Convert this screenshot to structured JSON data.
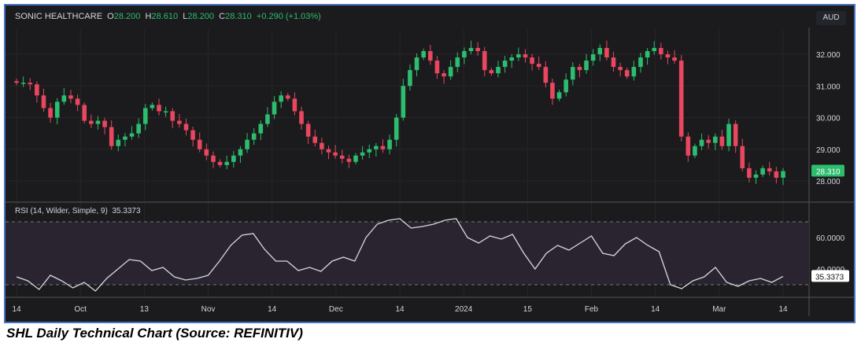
{
  "header": {
    "name": "SONIC HEALTHCARE",
    "o_label": "O",
    "o": "28.200",
    "h_label": "H",
    "h": "28.610",
    "l_label": "L",
    "l": "28.200",
    "c_label": "C",
    "c": "28.310",
    "change": "+0.290 (+1.03%)",
    "currency": "AUD"
  },
  "caption": "SHL Daily Technical Chart (Source: REFINITIV)",
  "colors": {
    "up": "#2dbd6e",
    "down": "#e8475f",
    "bg": "#1b1b1d",
    "rsi": "#d8d8dc",
    "rsi_band": "#2a2430"
  },
  "chart_data": [
    {
      "type": "candlestick",
      "title": "SONIC HEALTHCARE",
      "ylim": [
        27.6,
        33.0
      ],
      "yticks": [
        "32.000",
        "31.000",
        "30.000",
        "29.000",
        "28.000"
      ],
      "last_price": "28.310",
      "closes": [
        31.1,
        31.1,
        31.05,
        30.7,
        30.3,
        30.0,
        30.5,
        30.7,
        30.6,
        30.4,
        29.9,
        29.8,
        29.9,
        29.7,
        29.1,
        29.3,
        29.4,
        29.5,
        29.8,
        30.3,
        30.4,
        30.2,
        30.2,
        29.9,
        29.8,
        29.6,
        29.3,
        29.0,
        28.8,
        28.6,
        28.5,
        28.6,
        28.8,
        29.0,
        29.3,
        29.5,
        29.8,
        30.1,
        30.5,
        30.7,
        30.6,
        30.2,
        29.8,
        29.4,
        29.2,
        29.0,
        28.9,
        28.8,
        28.7,
        28.6,
        28.8,
        28.9,
        29.0,
        29.1,
        29.0,
        29.3,
        30.0,
        31.0,
        31.5,
        31.9,
        32.1,
        31.8,
        31.4,
        31.3,
        31.6,
        31.9,
        32.1,
        32.2,
        32.1,
        31.5,
        31.4,
        31.6,
        31.8,
        31.9,
        32.0,
        31.9,
        31.7,
        31.6,
        31.1,
        30.6,
        30.8,
        31.2,
        31.6,
        31.5,
        31.8,
        32.0,
        32.2,
        31.9,
        31.6,
        31.5,
        31.3,
        31.6,
        31.9,
        32.1,
        32.2,
        32.0,
        31.9,
        31.8,
        29.4,
        28.8,
        29.1,
        29.3,
        29.2,
        29.4,
        29.1,
        29.8,
        29.1,
        28.4,
        28.1,
        28.2,
        28.4,
        28.3,
        28.1,
        28.31
      ]
    },
    {
      "type": "line",
      "title": "RSI (14, Wilder, Simple, 9)",
      "current": "35.3373",
      "ylim": [
        20,
        78
      ],
      "yticks": [
        "60.0000",
        "40.0000"
      ],
      "bands": [
        30,
        70
      ],
      "values": [
        35,
        32.5,
        27,
        36,
        32.5,
        28,
        31.5,
        26,
        34,
        40,
        46,
        45,
        39,
        41,
        35,
        33,
        34,
        36,
        45,
        55,
        61.5,
        62.5,
        52.5,
        45,
        45,
        39,
        41,
        38.5,
        45,
        47.5,
        45,
        60,
        68.5,
        71,
        72,
        66,
        67,
        68.5,
        71,
        72,
        60,
        56.5,
        61,
        59,
        62,
        50,
        40,
        50,
        55,
        52,
        56.5,
        61,
        50,
        48.5,
        56,
        60,
        55,
        51,
        30,
        27.5,
        32.5,
        35,
        41,
        31.5,
        29,
        32.5,
        34,
        31.5,
        35.3
      ]
    },
    {
      "type": "axis",
      "xticks": [
        "14",
        "Oct",
        "13",
        "Nov",
        "14",
        "Dec",
        "14",
        "2024",
        "15",
        "Feb",
        "14",
        "Mar",
        "14"
      ]
    }
  ]
}
